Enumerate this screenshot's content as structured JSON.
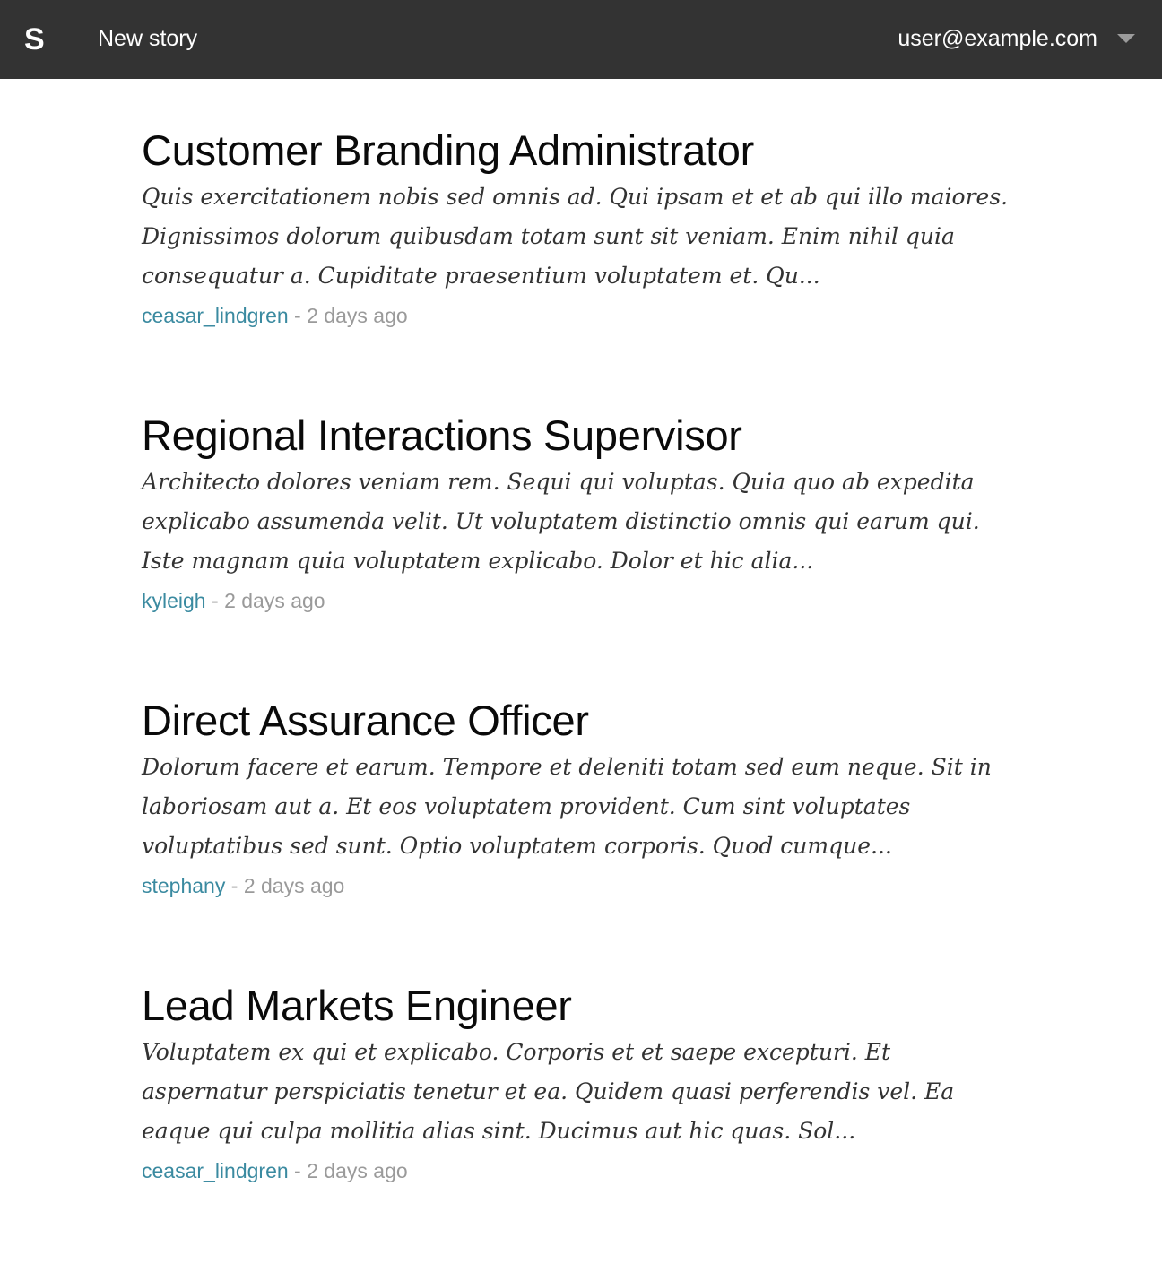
{
  "header": {
    "logo": "S",
    "new_story_label": "New story",
    "user_email": "user@example.com"
  },
  "stories": [
    {
      "title": "Customer Branding Administrator",
      "excerpt": "Quis exercitationem nobis sed omnis ad. Qui ipsam et et ab qui illo maiores. Dignissimos dolorum quibusdam totam sunt sit veniam. Enim nihil quia consequatur a. Cupiditate praesentium voluptatem et. Qu...",
      "author": "ceasar_lindgren",
      "separator": " - ",
      "time": "2 days ago"
    },
    {
      "title": "Regional Interactions Supervisor",
      "excerpt": "Architecto dolores veniam rem. Sequi qui voluptas. Quia quo ab expedita explicabo assumenda velit. Ut voluptatem distinctio omnis qui earum qui. Iste magnam quia voluptatem explicabo. Dolor et hic alia...",
      "author": "kyleigh",
      "separator": " - ",
      "time": "2 days ago"
    },
    {
      "title": "Direct Assurance Officer",
      "excerpt": "Dolorum facere et earum. Tempore et deleniti totam sed eum neque. Sit in laboriosam aut a. Et eos voluptatem provident. Cum sint voluptates voluptatibus sed sunt. Optio voluptatem corporis. Quod cumque...",
      "author": "stephany",
      "separator": " - ",
      "time": "2 days ago"
    },
    {
      "title": "Lead Markets Engineer",
      "excerpt": "Voluptatem ex qui et explicabo. Corporis et et saepe excepturi. Et aspernatur perspiciatis tenetur et ea. Quidem quasi perferendis vel. Ea eaque qui culpa mollitia alias sint. Ducimus aut hic quas. Sol...",
      "author": "ceasar_lindgren",
      "separator": " - ",
      "time": "2 days ago"
    }
  ],
  "colors": {
    "topbar": "#333333",
    "author_link": "#3a8aa0",
    "meta_text": "#9a9a9a",
    "caret": "#9b9b9b"
  },
  "icons": {
    "user_menu": "chevron-down-icon"
  }
}
